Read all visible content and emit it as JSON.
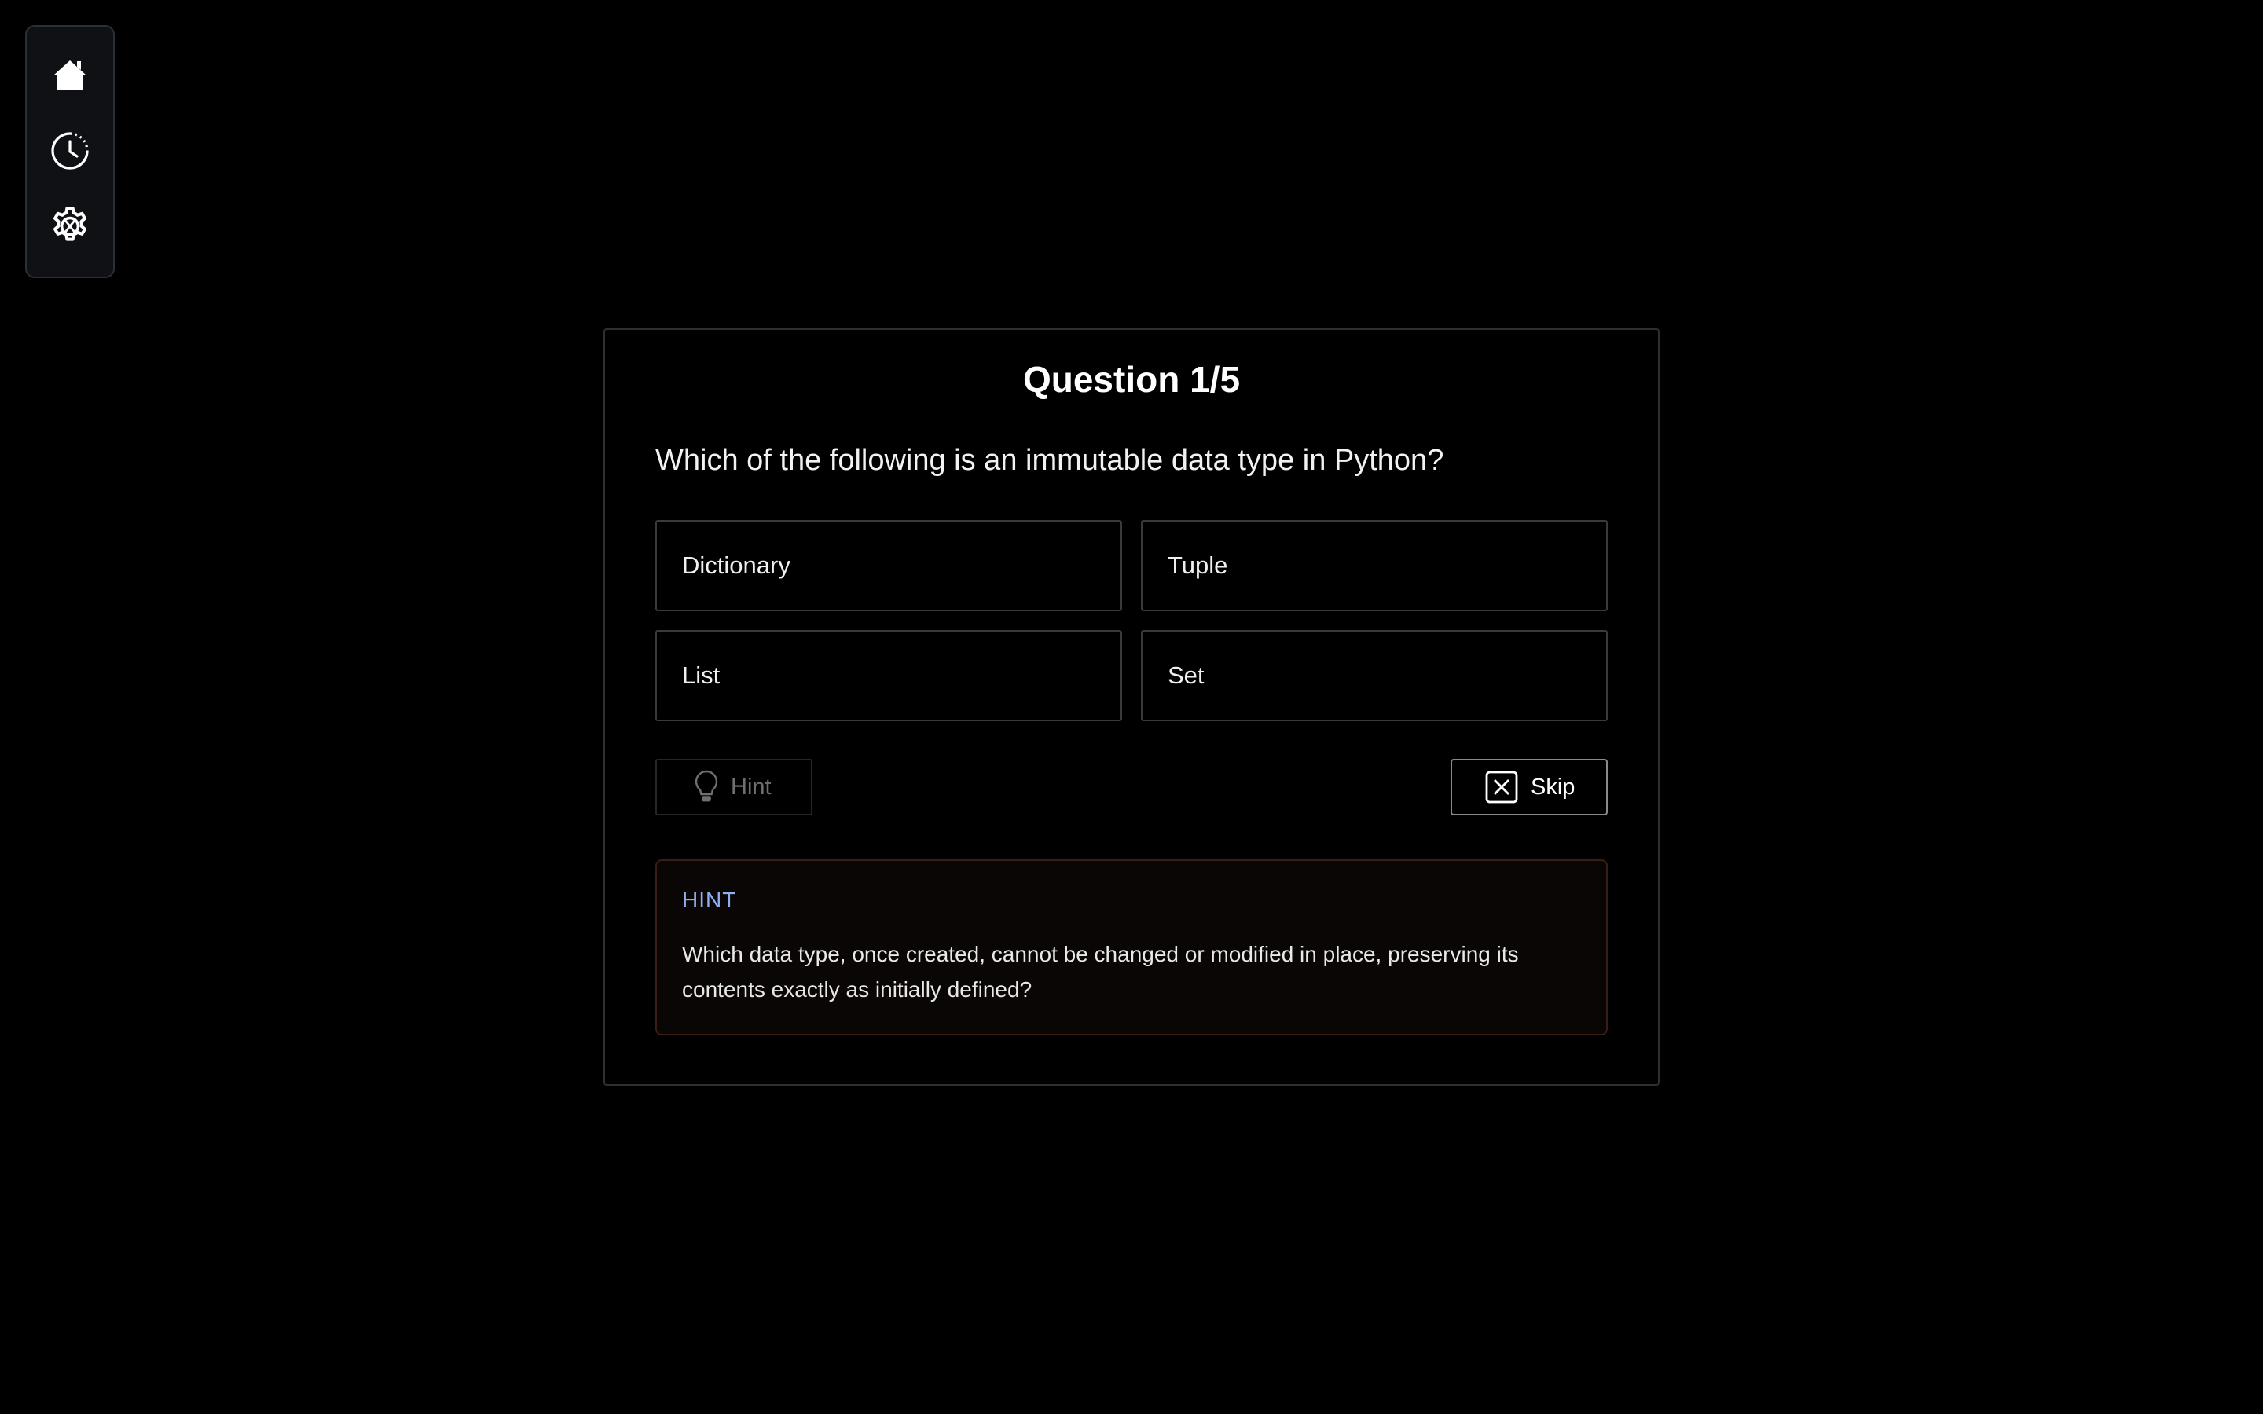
{
  "sidebar": {
    "items": [
      {
        "icon": "home-icon",
        "label": "Home"
      },
      {
        "icon": "history-icon",
        "label": "History"
      },
      {
        "icon": "settings-icon",
        "label": "Settings"
      }
    ]
  },
  "quiz": {
    "title": "Question 1/5",
    "question": "Which of the following is an immutable data type in Python?",
    "options": [
      "Dictionary",
      "Tuple",
      "List",
      "Set"
    ],
    "hint_button_label": "Hint",
    "skip_button_label": "Skip",
    "hint_panel": {
      "heading": "HINT",
      "text": "Which data type, once created, cannot be changed or modified in place, preserving its contents exactly as initially defined?"
    }
  },
  "colors": {
    "background": "#000000",
    "hint_heading": "#8fb0f0",
    "hint_border": "#3a1d14"
  }
}
